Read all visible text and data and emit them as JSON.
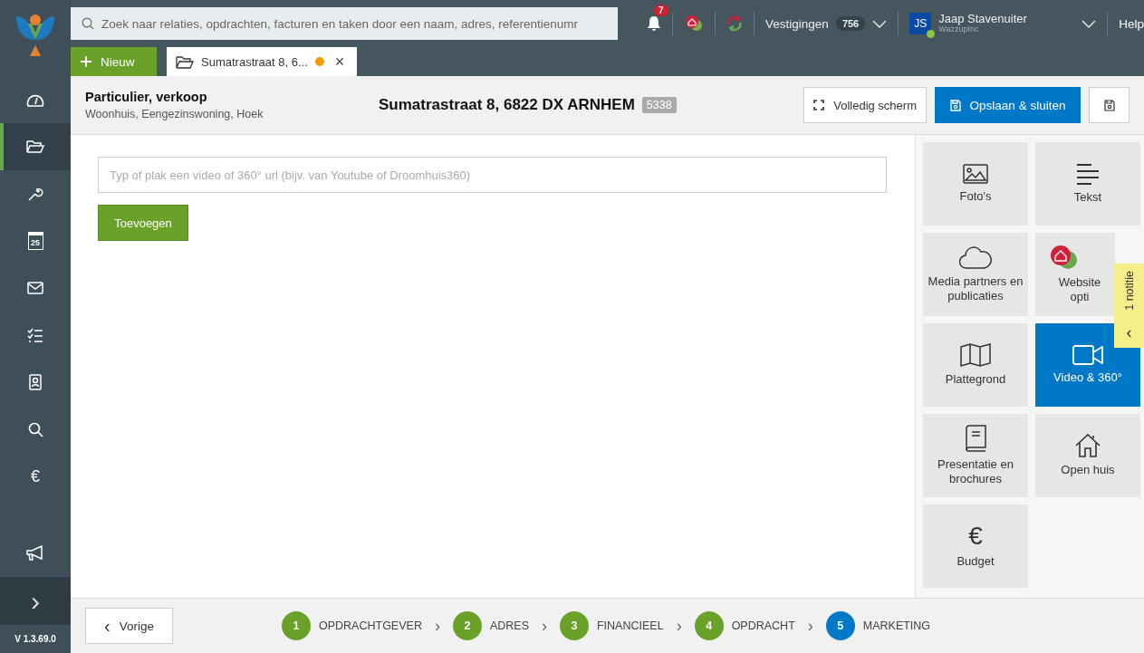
{
  "sidebar": {
    "items": [
      {
        "kind": "dashboard",
        "selected": false
      },
      {
        "kind": "folder",
        "selected": true
      },
      {
        "kind": "wrench",
        "selected": false
      },
      {
        "kind": "calendar",
        "label": "25",
        "selected": false
      },
      {
        "kind": "mail",
        "selected": false
      },
      {
        "kind": "checklist",
        "selected": false
      },
      {
        "kind": "contact",
        "selected": false
      },
      {
        "kind": "search",
        "selected": false
      },
      {
        "kind": "euro",
        "label": "€",
        "selected": false
      }
    ],
    "expand": "›",
    "version": "V 1.3.69.0"
  },
  "topbar": {
    "search_placeholder": "Zoek naar relaties, opdrachten, facturen en taken door een naam, adres, referentienumr",
    "notifications": "7",
    "branches_label": "Vestigingen",
    "branches_count": "756",
    "user_initials": "JS",
    "user_name": "Jaap Stavenuiter",
    "user_company": "WazzupInc",
    "help": "Help"
  },
  "tabs": {
    "new_button": "Nieuw",
    "open_tab": {
      "label": "Sumatrastraat 8, 6...",
      "unsaved": true,
      "close": "×"
    }
  },
  "header": {
    "title": "Particulier, verkoop",
    "subtitle": "Woonhuis, Eengezinswoning, Hoek",
    "address": "Sumatrastraat 8, 6822 DX ARNHEM",
    "number": "5338",
    "fullscreen": "Volledig scherm",
    "save_close": "Opslaan & sluiten"
  },
  "video_form": {
    "placeholder": "Typ of plak een video of 360° url (bijv. van Youtube of Droomhuis360)",
    "add_button": "Toevoegen"
  },
  "tiles": [
    {
      "kind": "photo",
      "label": "Foto's",
      "selected": false
    },
    {
      "kind": "text",
      "label": "Tekst",
      "selected": false
    },
    {
      "kind": "cloud",
      "label": "Media partners en publicaties",
      "selected": false
    },
    {
      "kind": "website",
      "label": "Website opti",
      "selected": false
    },
    {
      "kind": "map",
      "label": "Plattegrond",
      "selected": false
    },
    {
      "kind": "video",
      "label": "Video & 360°",
      "selected": true
    },
    {
      "kind": "book",
      "label": "Presentatie en brochures",
      "selected": false
    },
    {
      "kind": "house",
      "label": "Open huis",
      "selected": false
    },
    {
      "kind": "euro",
      "label": "Budget",
      "icon_text": "€",
      "selected": false
    }
  ],
  "note_tab": {
    "label": "1 notitie",
    "arrow": "‹"
  },
  "footer": {
    "back": "Vorige",
    "back_arrow": "‹",
    "separator": "›",
    "steps": [
      {
        "number": "1",
        "label": "OPDRACHTGEVER",
        "selected": false
      },
      {
        "number": "2",
        "label": "ADRES",
        "selected": false
      },
      {
        "number": "3",
        "label": "FINANCIEEL",
        "selected": false
      },
      {
        "number": "4",
        "label": "OPDRACHT",
        "selected": false
      },
      {
        "number": "5",
        "label": "MARKETING",
        "selected": true
      }
    ]
  }
}
